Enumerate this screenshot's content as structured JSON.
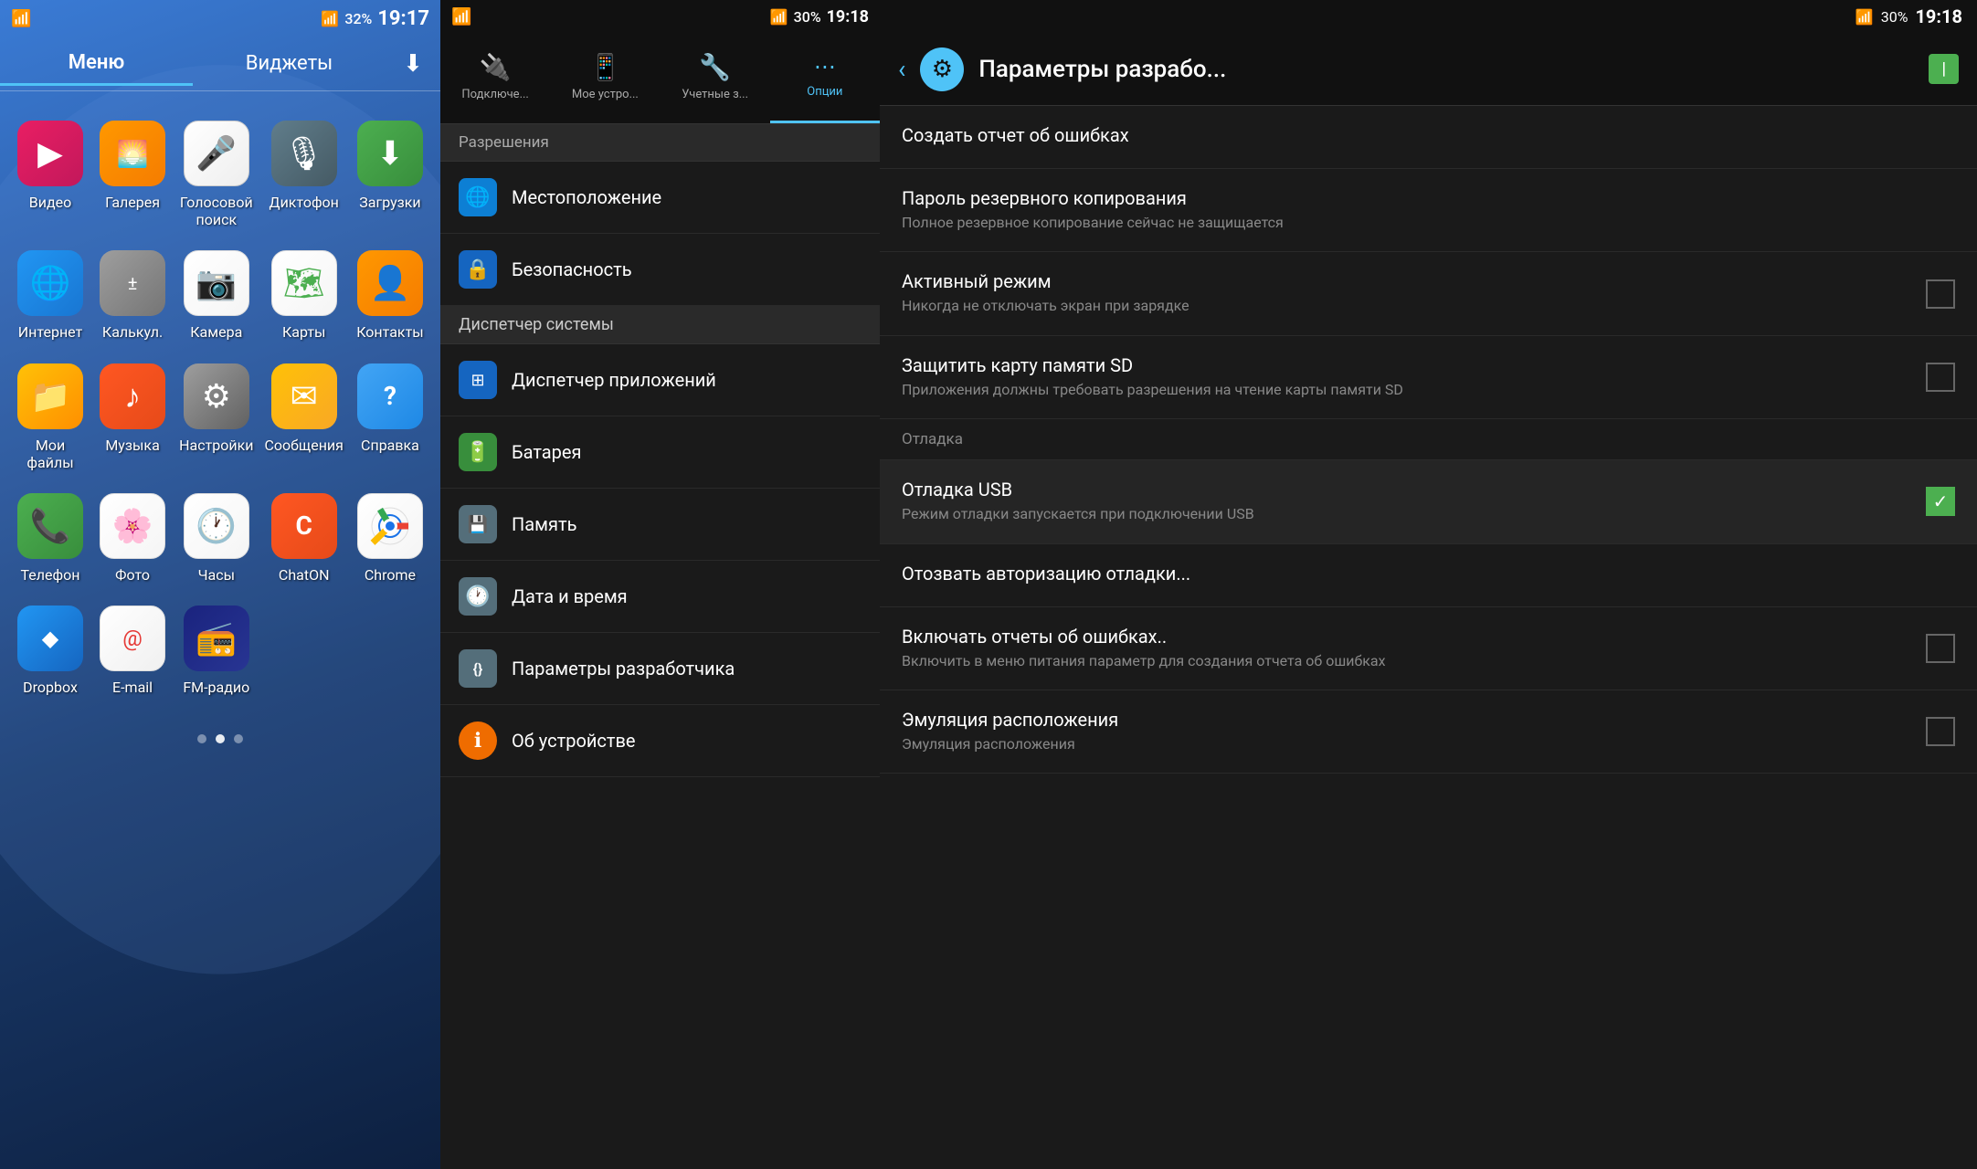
{
  "panel1": {
    "statusBar": {
      "leftIcons": "📶",
      "battery": "32%",
      "time": "19:17",
      "wifiIcon": "📶"
    },
    "tabs": [
      {
        "id": "menu",
        "label": "Меню",
        "active": true
      },
      {
        "id": "widgets",
        "label": "Виджеты",
        "active": false
      }
    ],
    "downloadIcon": "⬇",
    "apps": [
      {
        "id": "video",
        "label": "Видео",
        "icon": "▶",
        "iconClass": "icon-video"
      },
      {
        "id": "gallery",
        "label": "Галерея",
        "icon": "🌅",
        "iconClass": "icon-gallery"
      },
      {
        "id": "voice",
        "label": "Голосовой поиск",
        "icon": "🎤",
        "iconClass": "icon-voice"
      },
      {
        "id": "dictaphone",
        "label": "Диктофон",
        "icon": "🎙",
        "iconClass": "icon-dictaphone"
      },
      {
        "id": "downloads",
        "label": "Загрузки",
        "icon": "⬇",
        "iconClass": "icon-downloads"
      },
      {
        "id": "internet",
        "label": "Интернет",
        "icon": "🌐",
        "iconClass": "icon-internet"
      },
      {
        "id": "calc",
        "label": "Калькул.",
        "icon": "+-",
        "iconClass": "icon-calc"
      },
      {
        "id": "camera",
        "label": "Камера",
        "icon": "📷",
        "iconClass": "icon-camera"
      },
      {
        "id": "maps",
        "label": "Карты",
        "icon": "🗺",
        "iconClass": "icon-maps"
      },
      {
        "id": "contacts",
        "label": "Контакты",
        "icon": "👤",
        "iconClass": "icon-contacts"
      },
      {
        "id": "files",
        "label": "Мои файлы",
        "icon": "📁",
        "iconClass": "icon-files"
      },
      {
        "id": "music",
        "label": "Музыка",
        "icon": "♪",
        "iconClass": "icon-music"
      },
      {
        "id": "settings",
        "label": "Настройки",
        "icon": "⚙",
        "iconClass": "icon-settings"
      },
      {
        "id": "messages",
        "label": "Сообщения",
        "icon": "✉",
        "iconClass": "icon-messages"
      },
      {
        "id": "help",
        "label": "Справка",
        "icon": "?",
        "iconClass": "icon-help"
      },
      {
        "id": "phone",
        "label": "Телефон",
        "icon": "📞",
        "iconClass": "icon-phone"
      },
      {
        "id": "photos",
        "label": "Фото",
        "icon": "🌸",
        "iconClass": "icon-photos"
      },
      {
        "id": "clock",
        "label": "Часы",
        "icon": "🕐",
        "iconClass": "icon-clock"
      },
      {
        "id": "chaton",
        "label": "ChatON",
        "icon": "C",
        "iconClass": "icon-chaton"
      },
      {
        "id": "chrome",
        "label": "Chrome",
        "icon": "◉",
        "iconClass": "icon-chrome"
      },
      {
        "id": "dropbox",
        "label": "Dropbox",
        "icon": "◆",
        "iconClass": "icon-dropbox"
      },
      {
        "id": "email",
        "label": "E-mail",
        "icon": "@",
        "iconClass": "icon-email"
      },
      {
        "id": "fmradio",
        "label": "FM-радио",
        "icon": "📻",
        "iconClass": "icon-fmradio"
      }
    ],
    "dots": [
      {
        "active": false
      },
      {
        "active": true
      },
      {
        "active": false
      }
    ]
  },
  "panel2": {
    "statusBar": {
      "battery": "30%",
      "time": "19:18"
    },
    "tabs": [
      {
        "id": "connect",
        "label": "Подключе...",
        "icon": "🔌",
        "active": false
      },
      {
        "id": "mydevice",
        "label": "Мое устро...",
        "icon": "📱",
        "active": false
      },
      {
        "id": "accounts",
        "label": "Учетные з...",
        "icon": "🔧",
        "active": false
      },
      {
        "id": "options",
        "label": "Опции",
        "icon": "⋯",
        "active": true
      }
    ],
    "sectionHeader": "Разрешения",
    "items": [
      {
        "id": "location",
        "label": "Местоположение",
        "icon": "🌐",
        "iconBg": "#4fc3f7",
        "active": false
      },
      {
        "id": "security",
        "label": "Безопасность",
        "icon": "🔒",
        "iconBg": "#42a5f5",
        "active": false
      },
      {
        "id": "system_manager",
        "label": "Диспетчер системы",
        "icon": "",
        "iconBg": "",
        "isSection": true,
        "active": true
      },
      {
        "id": "app_manager",
        "label": "Диспетчер приложений",
        "icon": "⊞",
        "iconBg": "#42a5f5",
        "active": false
      },
      {
        "id": "battery",
        "label": "Батарея",
        "icon": "🔋",
        "iconBg": "#66bb6a",
        "active": false
      },
      {
        "id": "memory",
        "label": "Память",
        "icon": "💾",
        "iconBg": "#78909c",
        "active": false
      },
      {
        "id": "datetime",
        "label": "Дата и время",
        "icon": "🕐",
        "iconBg": "#78909c",
        "active": false
      },
      {
        "id": "devparams",
        "label": "Параметры разработчика",
        "icon": "{}",
        "iconBg": "#78909c",
        "active": false
      },
      {
        "id": "about",
        "label": "Об устройстве",
        "icon": "ℹ",
        "iconBg": "#ffa726",
        "active": false
      }
    ]
  },
  "panel3": {
    "statusBar": {
      "battery": "30%",
      "time": "19:18"
    },
    "header": {
      "backLabel": "‹",
      "gearIcon": "⚙",
      "title": "Параметры разрабо...",
      "batteryLabel": "I"
    },
    "items": [
      {
        "id": "bug_report",
        "title": "Создать отчет об ошибках",
        "subtitle": "",
        "hasCheckbox": false,
        "checked": false,
        "isPlain": true
      },
      {
        "id": "backup_pass",
        "title": "Пароль резервного копирования",
        "subtitle": "Полное резервное копирование сейчас не защищается",
        "hasCheckbox": false,
        "checked": false,
        "isPlain": false
      },
      {
        "id": "active_mode",
        "title": "Активный режим",
        "subtitle": "Никогда не отключать экран при зарядке",
        "hasCheckbox": true,
        "checked": false
      },
      {
        "id": "protect_sd",
        "title": "Защитить карту памяти SD",
        "subtitle": "Приложения должны требовать разрешения на чтение карты памяти SD",
        "hasCheckbox": true,
        "checked": false
      },
      {
        "id": "debug_section",
        "title": "Отладка",
        "isSection": true
      },
      {
        "id": "usb_debug",
        "title": "Отладка USB",
        "subtitle": "Режим отладки запускается при подключении USB",
        "hasCheckbox": true,
        "checked": true
      },
      {
        "id": "revoke_auth",
        "title": "Отозвать авторизацию отладки...",
        "subtitle": "",
        "hasCheckbox": false,
        "isPlain": true
      },
      {
        "id": "bug_reports",
        "title": "Включать отчеты об ошибках..",
        "subtitle": "Включить в меню питания параметр для создания отчета об ошибках",
        "hasCheckbox": true,
        "checked": false
      },
      {
        "id": "location_emul",
        "title": "Эмуляция расположения",
        "subtitle": "Эмуляция расположения",
        "hasCheckbox": true,
        "checked": false
      }
    ]
  }
}
